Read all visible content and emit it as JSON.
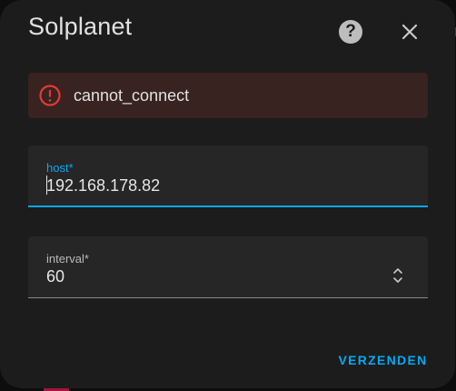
{
  "dialog": {
    "title": "Solplanet",
    "help_icon": "help-circle-icon",
    "close_icon": "close-icon"
  },
  "error": {
    "icon": "alert-circle-icon",
    "message": "cannot_connect",
    "color": "#e53935"
  },
  "form": {
    "host": {
      "label": "host*",
      "value": "192.168.178.82"
    },
    "interval": {
      "label": "interval*",
      "value": "60",
      "spinner_icon": "spinner-arrows-icon"
    }
  },
  "actions": {
    "submit_label": "VERZENDEN"
  },
  "colors": {
    "accent": "#03a9f4",
    "dialog_bg": "#1c1c1c",
    "error_bg": "#382320"
  }
}
